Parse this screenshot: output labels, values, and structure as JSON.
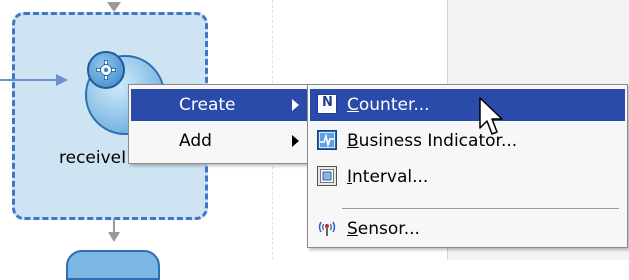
{
  "process_canvas": {
    "activity_label": "receiveI"
  },
  "context_menu": {
    "items": [
      {
        "label": "Create",
        "has_submenu": true,
        "highlighted": true
      },
      {
        "label": "Add",
        "has_submenu": true,
        "highlighted": false
      }
    ]
  },
  "create_submenu": {
    "items": [
      {
        "icon": "counter-icon",
        "icon_text": "N",
        "mnemonic": "C",
        "rest": "ounter...",
        "highlighted": true
      },
      {
        "icon": "business-indicator-icon",
        "mnemonic": "B",
        "rest": "usiness Indicator...",
        "highlighted": false
      },
      {
        "icon": "interval-icon",
        "mnemonic": "I",
        "rest": "nterval...",
        "highlighted": false
      },
      {
        "icon": "sensor-icon",
        "mnemonic": "S",
        "rest": "ensor...",
        "highlighted": false
      }
    ]
  },
  "colors": {
    "menu_highlight": "#2b4bab",
    "activity_border": "#3f76c6",
    "activity_fill": "#cfe4f2"
  }
}
